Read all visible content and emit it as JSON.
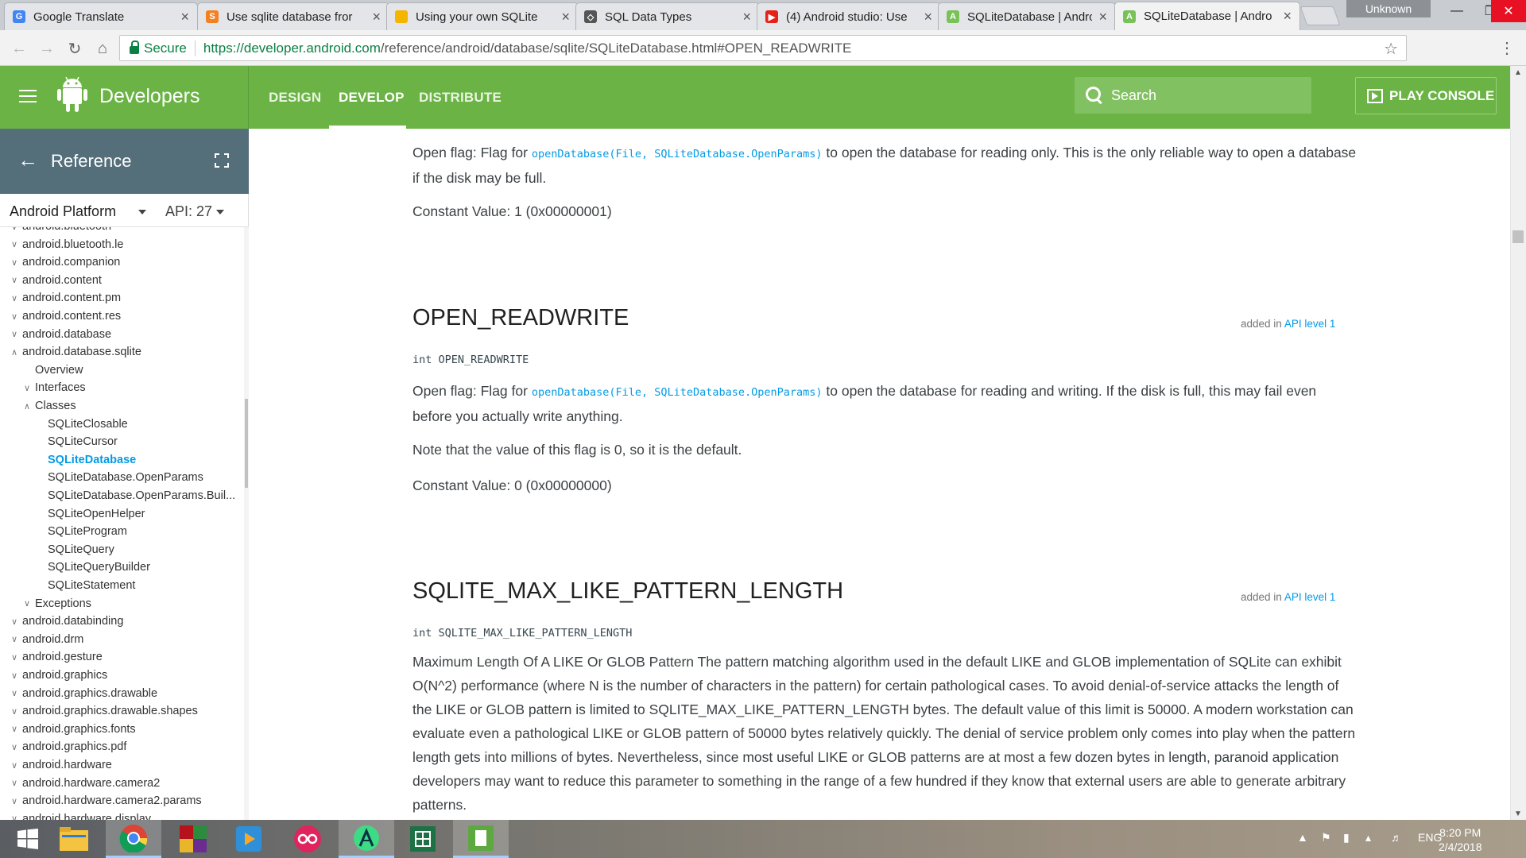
{
  "browser": {
    "tabs": [
      {
        "title": "Google Translate",
        "favicon": "google-translate-icon",
        "color": "#4285f4"
      },
      {
        "title": "Use sqlite database fror",
        "favicon": "stackoverflow-icon",
        "color": "#f48024"
      },
      {
        "title": "Using your own SQLite",
        "favicon": "folder-icon",
        "color": "#f4b400"
      },
      {
        "title": "SQL Data Types",
        "favicon": "diamond-icon",
        "color": "#555555"
      },
      {
        "title": "(4) Android studio: Use",
        "favicon": "youtube-icon",
        "color": "#e62117"
      },
      {
        "title": "SQLiteDatabase | Andro",
        "favicon": "android-icon",
        "color": "#78c257"
      },
      {
        "title": "SQLiteDatabase | Andro",
        "favicon": "android-icon",
        "color": "#78c257"
      }
    ],
    "profile_label": "Unknown",
    "security_label": "Secure",
    "url_origin": "https://developer.android.com",
    "url_path": "/reference/android/database/sqlite/SQLiteDatabase.html#OPEN_READWRITE"
  },
  "site": {
    "brand": "Developers",
    "nav": [
      "DESIGN",
      "DEVELOP",
      "DISTRIBUTE"
    ],
    "search_placeholder": "Search",
    "play_console": "PLAY CONSOLE",
    "accent_color": "#6ab344"
  },
  "sidebar": {
    "title": "Reference",
    "platform": "Android Platform",
    "api": "API: 27",
    "items": [
      {
        "label": "android.bluetooth",
        "level": 0,
        "state": "collapsed"
      },
      {
        "label": "android.bluetooth.le",
        "level": 0,
        "state": "collapsed"
      },
      {
        "label": "android.companion",
        "level": 0,
        "state": "collapsed"
      },
      {
        "label": "android.content",
        "level": 0,
        "state": "collapsed"
      },
      {
        "label": "android.content.pm",
        "level": 0,
        "state": "collapsed"
      },
      {
        "label": "android.content.res",
        "level": 0,
        "state": "collapsed"
      },
      {
        "label": "android.database",
        "level": 0,
        "state": "collapsed"
      },
      {
        "label": "android.database.sqlite",
        "level": 0,
        "state": "expanded"
      },
      {
        "label": "Overview",
        "level": 1,
        "state": "none"
      },
      {
        "label": "Interfaces",
        "level": 1,
        "state": "collapsed"
      },
      {
        "label": "Classes",
        "level": 1,
        "state": "expanded"
      },
      {
        "label": "SQLiteClosable",
        "level": 2,
        "state": "none"
      },
      {
        "label": "SQLiteCursor",
        "level": 2,
        "state": "none"
      },
      {
        "label": "SQLiteDatabase",
        "level": 2,
        "state": "selected"
      },
      {
        "label": "SQLiteDatabase.OpenParams",
        "level": 2,
        "state": "none"
      },
      {
        "label": "SQLiteDatabase.OpenParams.Buil...",
        "level": 2,
        "state": "none"
      },
      {
        "label": "SQLiteOpenHelper",
        "level": 2,
        "state": "none"
      },
      {
        "label": "SQLiteProgram",
        "level": 2,
        "state": "none"
      },
      {
        "label": "SQLiteQuery",
        "level": 2,
        "state": "none"
      },
      {
        "label": "SQLiteQueryBuilder",
        "level": 2,
        "state": "none"
      },
      {
        "label": "SQLiteStatement",
        "level": 2,
        "state": "none"
      },
      {
        "label": "Exceptions",
        "level": 1,
        "state": "collapsed"
      },
      {
        "label": "android.databinding",
        "level": 0,
        "state": "collapsed"
      },
      {
        "label": "android.drm",
        "level": 0,
        "state": "collapsed"
      },
      {
        "label": "android.gesture",
        "level": 0,
        "state": "collapsed"
      },
      {
        "label": "android.graphics",
        "level": 0,
        "state": "collapsed"
      },
      {
        "label": "android.graphics.drawable",
        "level": 0,
        "state": "collapsed"
      },
      {
        "label": "android.graphics.drawable.shapes",
        "level": 0,
        "state": "collapsed"
      },
      {
        "label": "android.graphics.fonts",
        "level": 0,
        "state": "collapsed"
      },
      {
        "label": "android.graphics.pdf",
        "level": 0,
        "state": "collapsed"
      },
      {
        "label": "android.hardware",
        "level": 0,
        "state": "collapsed"
      },
      {
        "label": "android.hardware.camera2",
        "level": 0,
        "state": "collapsed"
      },
      {
        "label": "android.hardware.camera2.params",
        "level": 0,
        "state": "collapsed"
      },
      {
        "label": "android.hardware.display",
        "level": 0,
        "state": "collapsed"
      }
    ]
  },
  "content": {
    "open_readonly": {
      "desc_pre": "Open flag: Flag for ",
      "desc_code": "openDatabase(File, SQLiteDatabase.OpenParams)",
      "desc_post": " to open the database for reading only. This is the only reliable way to open a database if the disk may be full.",
      "constant": "Constant Value: 1 (0x00000001)"
    },
    "open_readwrite": {
      "title": "OPEN_READWRITE",
      "added_pre": "added in ",
      "added_link": "API level 1",
      "signature": "int OPEN_READWRITE",
      "desc_pre": "Open flag: Flag for ",
      "desc_code": "openDatabase(File, SQLiteDatabase.OpenParams)",
      "desc_post": " to open the database for reading and writing. If the disk is full, this may fail even before you actually write anything.",
      "note": "Note that the value of this flag is 0, so it is the default.",
      "constant": "Constant Value: 0 (0x00000000)"
    },
    "max_like": {
      "title": "SQLITE_MAX_LIKE_PATTERN_LENGTH",
      "added_pre": "added in ",
      "added_link": "API level 1",
      "signature": "int SQLITE_MAX_LIKE_PATTERN_LENGTH",
      "desc": "Maximum Length Of A LIKE Or GLOB Pattern The pattern matching algorithm used in the default LIKE and GLOB implementation of SQLite can exhibit O(N^2) performance (where N is the number of characters in the pattern) for certain pathological cases. To avoid denial-of-service attacks the length of the LIKE or GLOB pattern is limited to SQLITE_MAX_LIKE_PATTERN_LENGTH bytes. The default value of this limit is 50000. A modern workstation can evaluate even a pathological LIKE or GLOB pattern of 50000 bytes relatively quickly. The denial of service problem only comes into play when the pattern length gets into millions of bytes. Nevertheless, since most useful LIKE or GLOB patterns are at most a few dozen bytes in length, paranoid application developers may want to reduce this parameter to something in the range of a few hundred if they know that external users are able to generate arbitrary patterns."
    }
  },
  "taskbar": {
    "apps": [
      "windows-start-icon",
      "file-explorer-icon",
      "chrome-icon",
      "winrar-icon",
      "media-player-icon",
      "fling-icon",
      "android-studio-icon",
      "excel-icon",
      "notepad-icon"
    ],
    "language": "ENG",
    "time": "8:20 PM",
    "date": "2/4/2018"
  }
}
